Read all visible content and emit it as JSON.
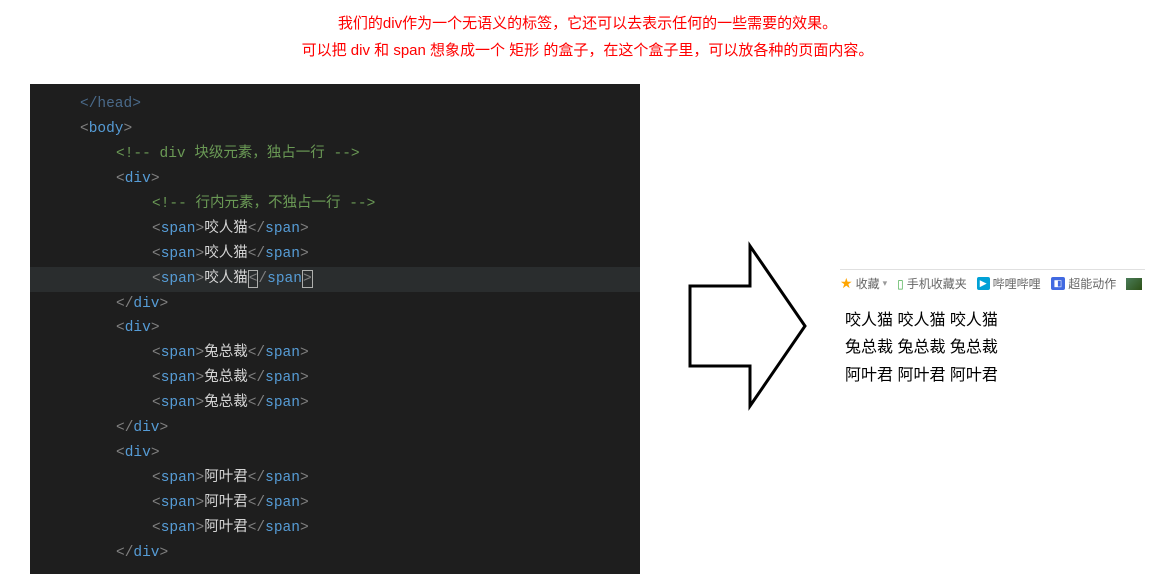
{
  "description": {
    "line1": "我们的div作为一个无语义的标签，它还可以去表示任何的一些需要的效果。",
    "line2": "可以把 div 和 span 想象成一个 矩形 的盒子，在这个盒子里，可以放各种的页面内容。"
  },
  "code": {
    "tags": {
      "body": "body",
      "div": "div",
      "span": "span"
    },
    "comments": {
      "block": "<!-- div 块级元素，独占一行 -->",
      "inline": "<!-- 行内元素，不独占一行 -->"
    },
    "texts": {
      "cat": "咬人猫",
      "rabbit": "兔总裁",
      "aye": "阿叶君"
    },
    "faded_head": "</head>"
  },
  "bookmarks": {
    "favorite": "收藏",
    "mobile": "手机收藏夹",
    "bilibili": "哔哩哔哩",
    "hero": "超能动作"
  },
  "output": {
    "line1": "咬人猫 咬人猫 咬人猫",
    "line2": "兔总裁 兔总裁 兔总裁",
    "line3": "阿叶君 阿叶君 阿叶君"
  }
}
